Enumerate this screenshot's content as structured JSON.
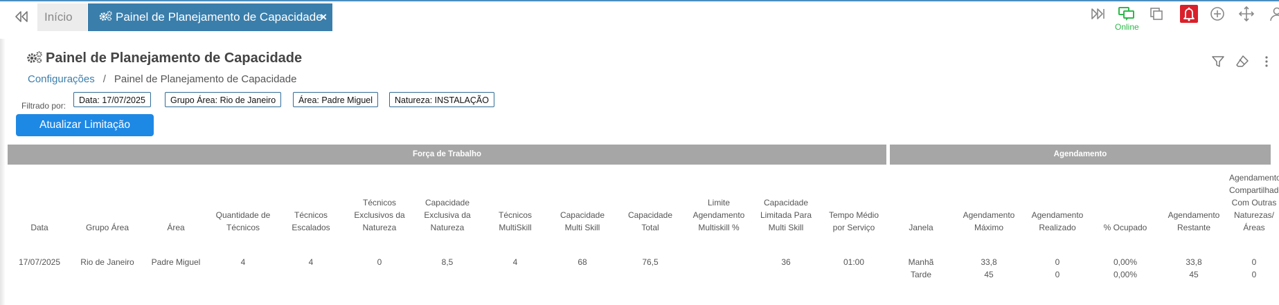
{
  "tabs": {
    "home_label": "Início",
    "active_label": "Painel de Planejamento de Capacidade",
    "close_glyph": "×"
  },
  "status": {
    "online_label": "Online",
    "online_color": "#2db84a",
    "alert_color": "#d9212b"
  },
  "page": {
    "title": "Painel de Planejamento de Capacidade",
    "breadcrumb": {
      "parent": "Configurações",
      "separator": "/",
      "current": "Painel de Planejamento de Capacidade"
    }
  },
  "filters": {
    "label": "Filtrado por:",
    "chips": [
      "Data: 17/07/2025",
      "Grupo Área: Rio de Janeiro",
      "Área: Padre Miguel",
      "Natureza: INSTALAÇÃO"
    ]
  },
  "actions": {
    "update_label": "Atualizar Limitação"
  },
  "table": {
    "groups": [
      "Força de Trabalho",
      "Agendamento"
    ],
    "columns": [
      "Data",
      "Grupo Área",
      "Área",
      "Quantidade de Técnicos",
      "Técnicos Escalados",
      "Técnicos Exclusivos da Natureza",
      "Capacidade Exclusiva da Natureza",
      "Técnicos MultiSkill",
      "Capacidade Multi Skill",
      "Capacidade Total",
      "Limite Agendamento Multiskill %",
      "Capacidade Limitada Para Multi Skill",
      "Tempo Médio por Serviço",
      "Janela",
      "Agendamento Máximo",
      "Agendamento Realizado",
      "% Ocupado",
      "Agendamento Restante",
      "Agendamento Compartilhado Com Outras Naturezas/ Áreas"
    ],
    "row": [
      "17/07/2025",
      "Rio de Janeiro",
      "Padre Miguel",
      "4",
      "4",
      "0",
      "8,5",
      "4",
      "68",
      "76,5",
      "",
      "36",
      "01:00"
    ],
    "windows": [
      {
        "janela": "Manhã",
        "maximo": "33,8",
        "realizado": "0",
        "ocupado": "0,00%",
        "restante": "33,8",
        "compartilhado": "0"
      },
      {
        "janela": "Tarde",
        "maximo": "45",
        "realizado": "0",
        "ocupado": "0,00%",
        "restante": "45",
        "compartilhado": "0"
      }
    ]
  },
  "icons": [
    "double-chevron-left-icon",
    "gears-icon",
    "close-icon",
    "forward-icon",
    "chat-icon",
    "copy-icon",
    "bell-icon",
    "add-circle-icon",
    "move-icon",
    "user-icon",
    "filter-icon",
    "eraser-icon",
    "more-vertical-icon"
  ]
}
